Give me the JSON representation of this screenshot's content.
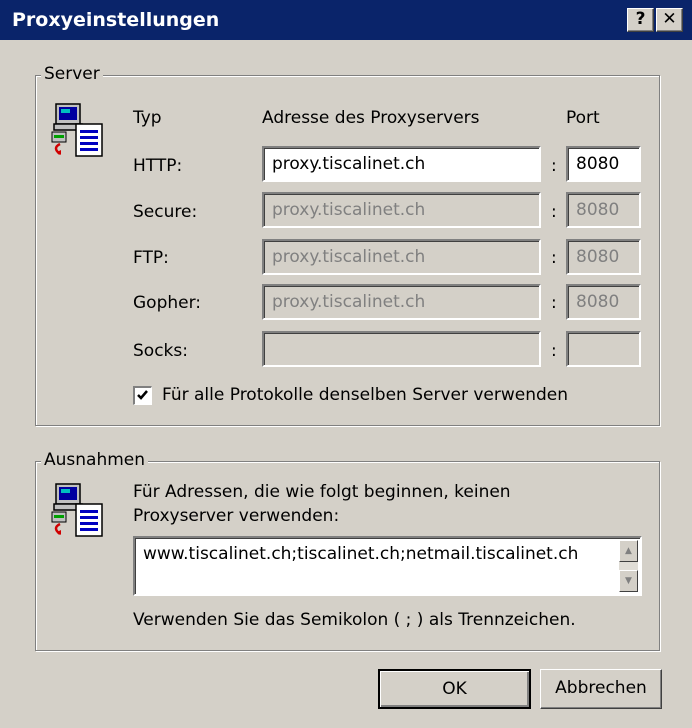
{
  "window": {
    "title": "Proxyeinstellungen",
    "help_label": "?",
    "close_label": "✕"
  },
  "server": {
    "group_label": "Server",
    "col_type": "Typ",
    "col_address": "Adresse des Proxyservers",
    "col_port": "Port",
    "separator": ":",
    "rows": [
      {
        "label": "HTTP:",
        "address": "proxy.tiscalinet.ch",
        "port": "8080",
        "enabled": true
      },
      {
        "label": "Secure:",
        "address": "proxy.tiscalinet.ch",
        "port": "8080",
        "enabled": false
      },
      {
        "label": "FTP:",
        "address": "proxy.tiscalinet.ch",
        "port": "8080",
        "enabled": false
      },
      {
        "label": "Gopher:",
        "address": "proxy.tiscalinet.ch",
        "port": "8080",
        "enabled": false
      },
      {
        "label": "Socks:",
        "address": "",
        "port": "",
        "enabled": false
      }
    ],
    "same_server_checkbox": {
      "label": "Für alle Protokolle denselben Server verwenden",
      "checked": true
    }
  },
  "exceptions": {
    "group_label": "Ausnahmen",
    "description_line1": "Für Adressen, die wie folgt beginnen, keinen",
    "description_line2": "Proxyserver verwenden:",
    "value": "www.tiscalinet.ch;tiscalinet.ch;netmail.tiscalinet.ch",
    "hint": "Verwenden Sie das Semikolon ( ; ) als Trennzeichen."
  },
  "buttons": {
    "ok_label": "OK",
    "cancel_label": "Abbrechen"
  },
  "colors": {
    "titlebar": "#0a246a",
    "face": "#d4d0c8",
    "disabled_text": "#808080"
  },
  "icons": [
    "network-computer-icon",
    "document-icon",
    "checkmark-icon",
    "scroll-up-arrow-icon",
    "scroll-down-arrow-icon"
  ]
}
